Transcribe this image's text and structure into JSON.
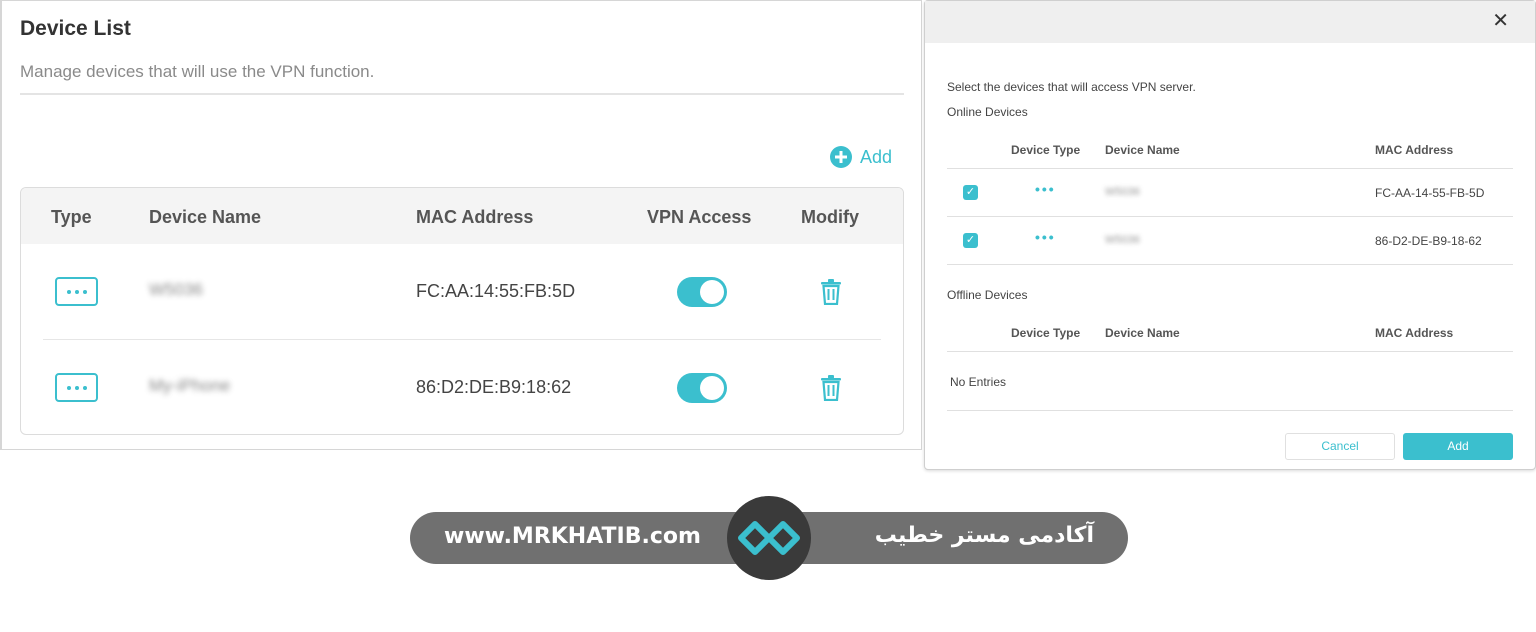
{
  "device_list": {
    "title": "Device List",
    "subtitle": "Manage devices that will use the VPN function.",
    "add_label": "Add",
    "columns": [
      "Type",
      "Device Name",
      "MAC Address",
      "VPN Access",
      "Modify"
    ],
    "rows": [
      {
        "name": "W5036",
        "mac": "FC:AA:14:55:FB:5D",
        "vpn_access": true
      },
      {
        "name": "My-iPhone",
        "mac": "86:D2:DE:B9:18:62",
        "vpn_access": true
      }
    ]
  },
  "dialog": {
    "close_symbol": "✕",
    "instruction": "Select the devices that will access VPN server.",
    "online_heading": "Online Devices",
    "offline_heading": "Offline Devices",
    "columns": [
      "Device Type",
      "Device Name",
      "MAC Address"
    ],
    "online_rows": [
      {
        "checked": true,
        "type_glyph": "•••",
        "name": "W5036",
        "mac": "FC-AA-14-55-FB-5D"
      },
      {
        "checked": true,
        "type_glyph": "•••",
        "name": "W5036",
        "mac": "86-D2-DE-B9-18-62"
      }
    ],
    "offline_empty": "No Entries",
    "cancel_label": "Cancel",
    "add_label": "Add"
  },
  "banner": {
    "url": "www.MRKHATIB.com",
    "persian_text": "آکادمی مستر خطیب"
  },
  "colors": {
    "accent": "#3bbfce",
    "banner_bg": "#707070",
    "logo_bg": "#3a3a3a"
  },
  "icons": [
    "plus-circle-icon",
    "more-dots-icon",
    "trash-icon",
    "checkbox-checked-icon",
    "close-icon",
    "brand-logo-icon"
  ]
}
